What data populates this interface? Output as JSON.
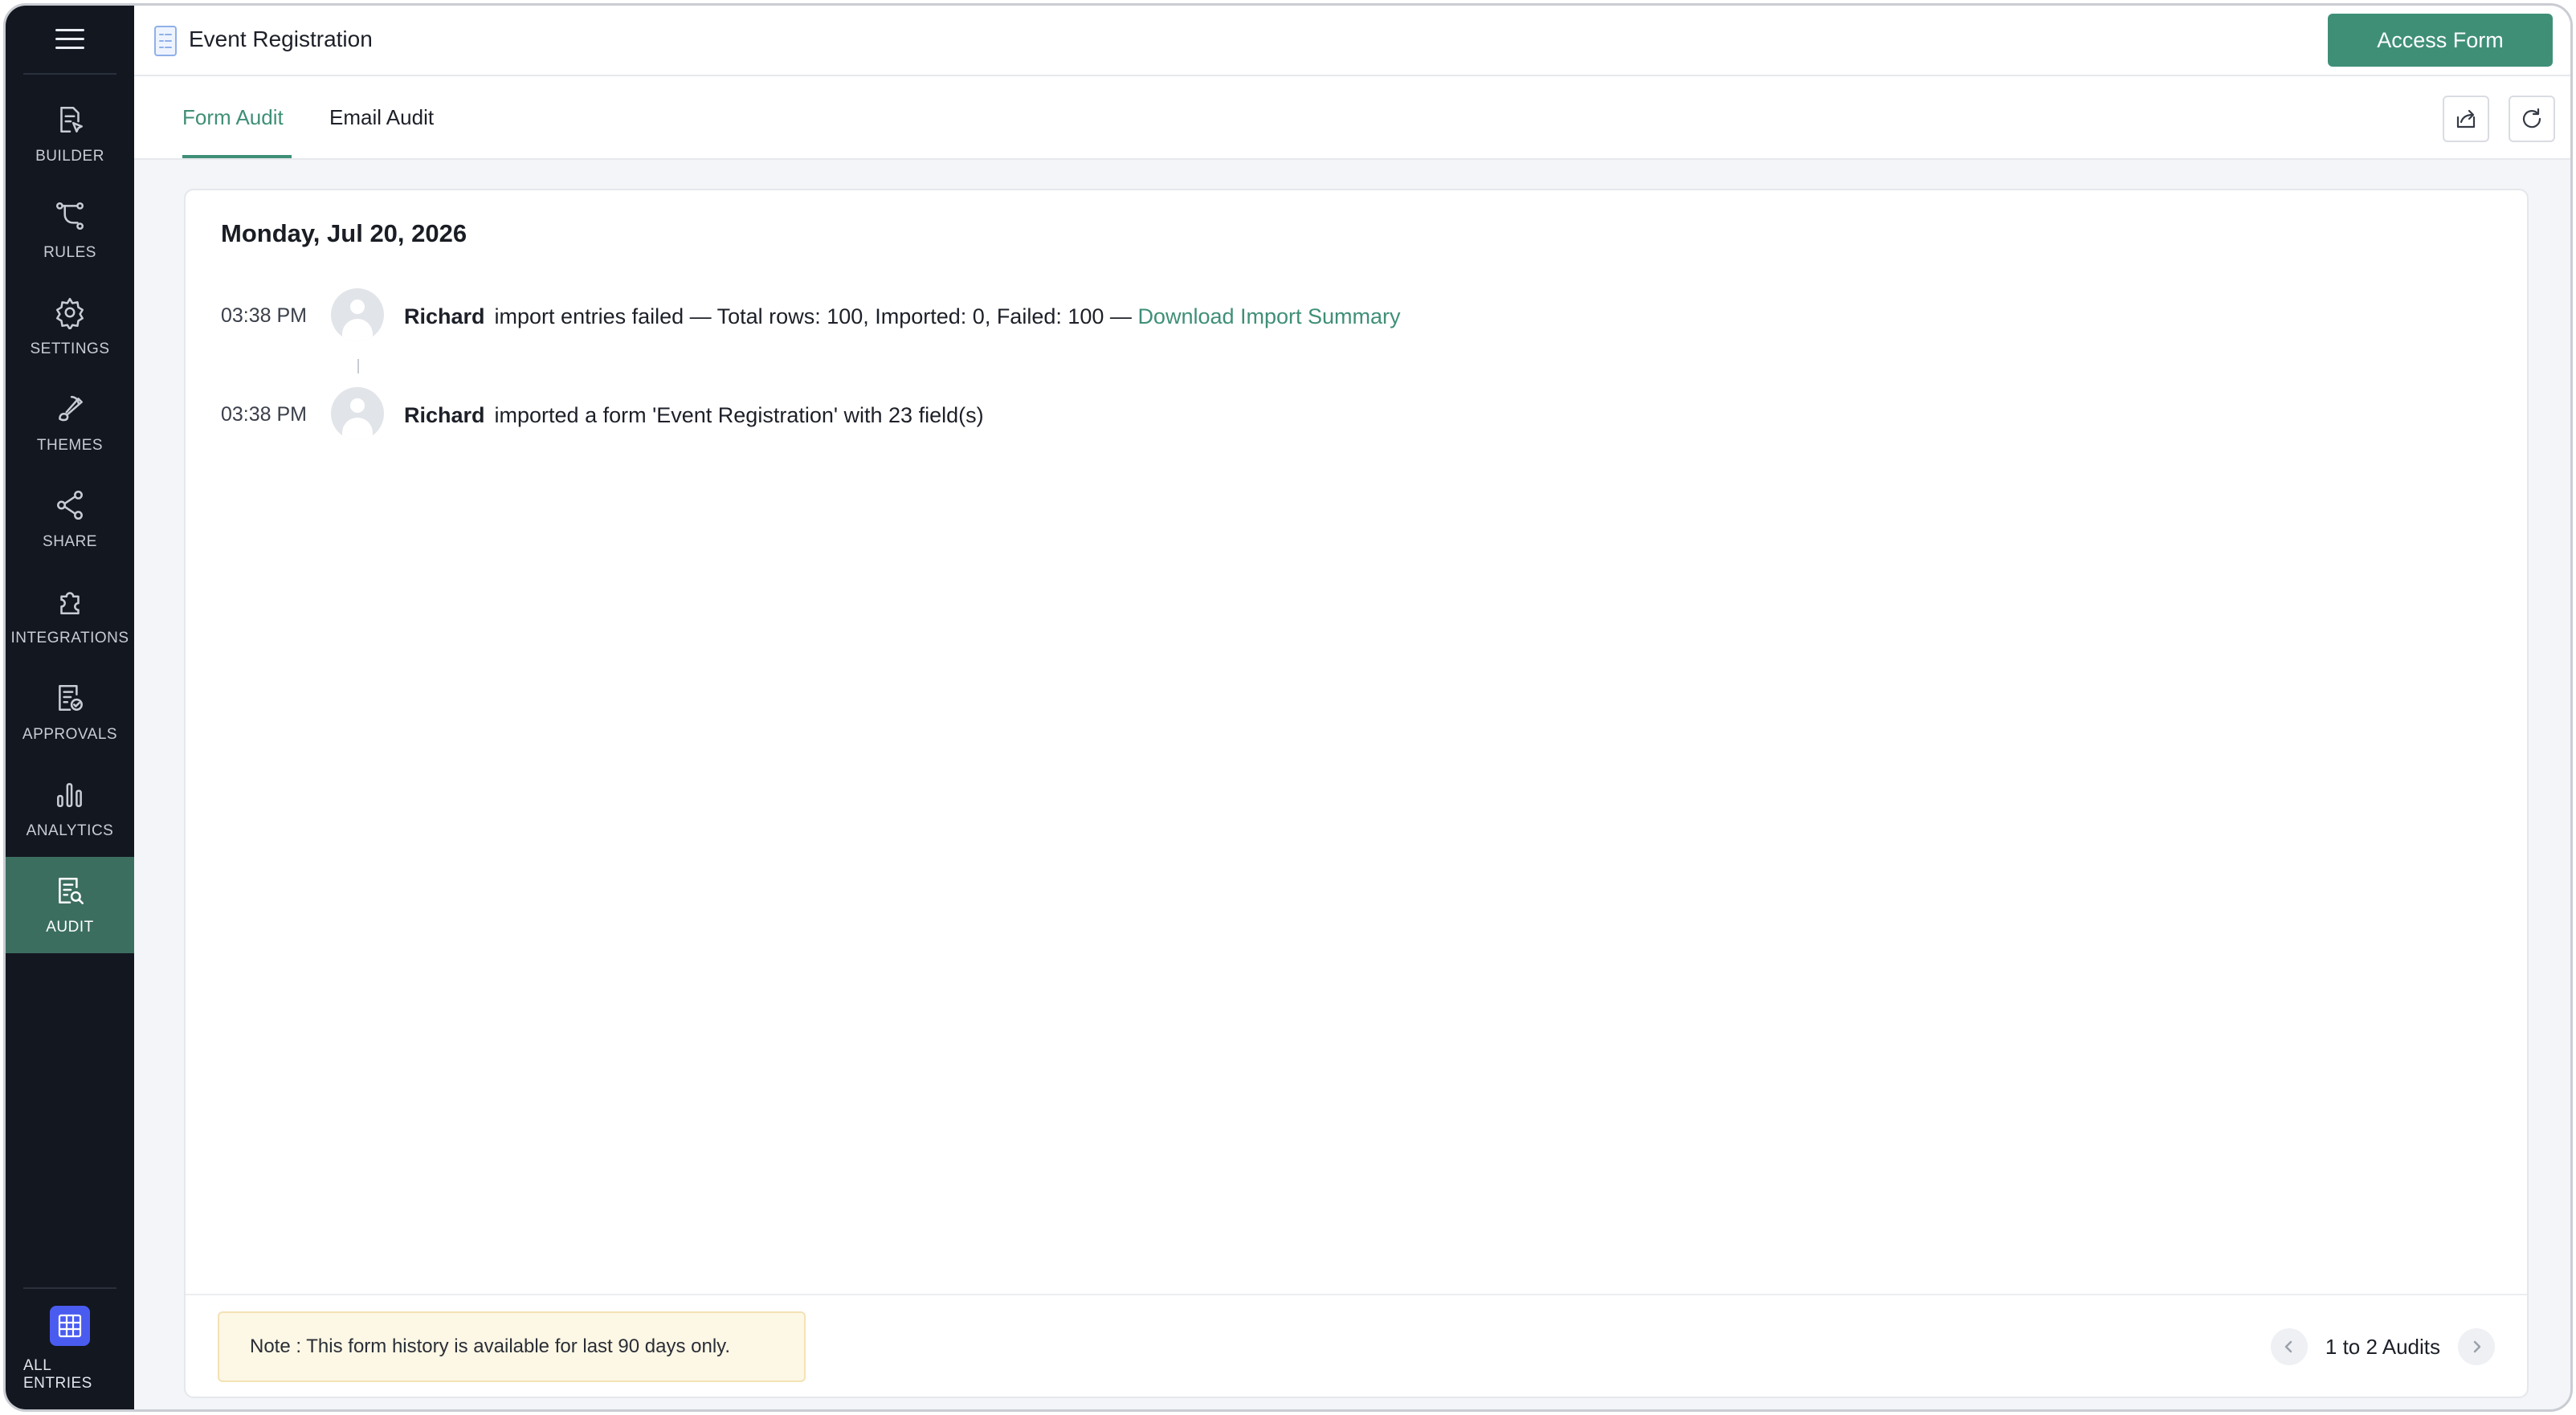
{
  "header": {
    "title": "Event Registration",
    "access_button": "Access Form"
  },
  "sidebar": {
    "items": [
      {
        "label": "BUILDER",
        "icon": "builder-icon"
      },
      {
        "label": "RULES",
        "icon": "rules-icon"
      },
      {
        "label": "SETTINGS",
        "icon": "gear-icon"
      },
      {
        "label": "THEMES",
        "icon": "brush-icon"
      },
      {
        "label": "SHARE",
        "icon": "share-icon"
      },
      {
        "label": "INTEGRATIONS",
        "icon": "puzzle-icon"
      },
      {
        "label": "APPROVALS",
        "icon": "approvals-icon"
      },
      {
        "label": "ANALYTICS",
        "icon": "bar-chart-icon"
      },
      {
        "label": "AUDIT",
        "icon": "audit-icon",
        "active": true
      }
    ],
    "bottom": {
      "label": "ALL ENTRIES",
      "icon": "grid-icon"
    }
  },
  "tabs": [
    {
      "label": "Form Audit",
      "active": true
    },
    {
      "label": "Email Audit",
      "active": false
    }
  ],
  "audit": {
    "date": "Monday, Jul 20, 2026",
    "entries": [
      {
        "time": "03:38 PM",
        "user": "Richard",
        "text": "import entries failed — Total rows: 100, Imported: 0, Failed: 100 —",
        "link": "Download Import Summary"
      },
      {
        "time": "03:38 PM",
        "user": "Richard",
        "text": "imported a form 'Event Registration' with 23 field(s)"
      }
    ]
  },
  "footer": {
    "note": "Note : This form history is available for last 90 days only.",
    "pagination": "1 to 2 Audits"
  },
  "colors": {
    "accent": "#3f8f77",
    "sidebar_bg": "#131720",
    "active_nav_bg": "#3c6e5f",
    "all_entries_bg": "#4a5cf0"
  }
}
